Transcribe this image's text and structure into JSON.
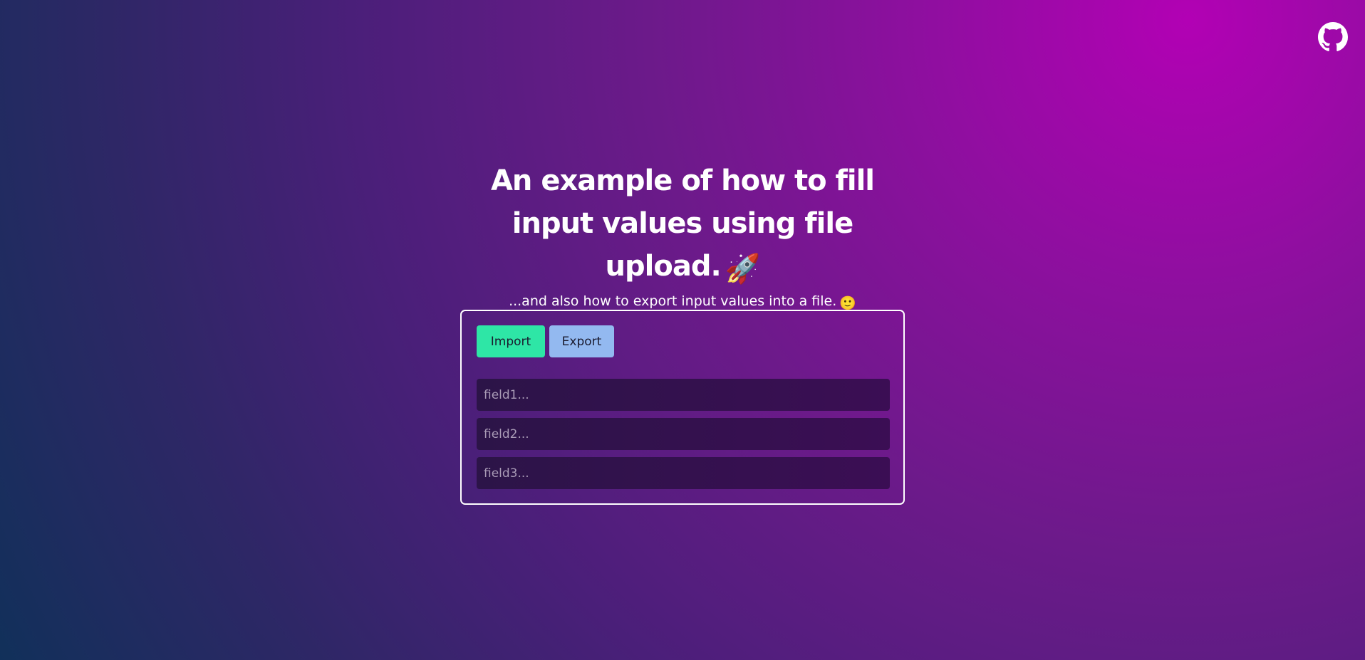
{
  "header": {
    "github_icon": "github-icon"
  },
  "hero": {
    "title": "An example of how to fill input values using file upload.",
    "title_emoji": "🚀",
    "subtitle": "...and also how to export input values into a file.",
    "subtitle_emoji": "🙂"
  },
  "panel": {
    "import_label": "Import",
    "export_label": "Export",
    "fields": [
      {
        "value": "",
        "placeholder": "field1..."
      },
      {
        "value": "",
        "placeholder": "field2..."
      },
      {
        "value": "",
        "placeholder": "field3..."
      }
    ]
  },
  "colors": {
    "import_button": "#2ee6a6",
    "export_button": "#93b9f0",
    "background_start": "#11305a",
    "background_end": "#b201b4"
  }
}
